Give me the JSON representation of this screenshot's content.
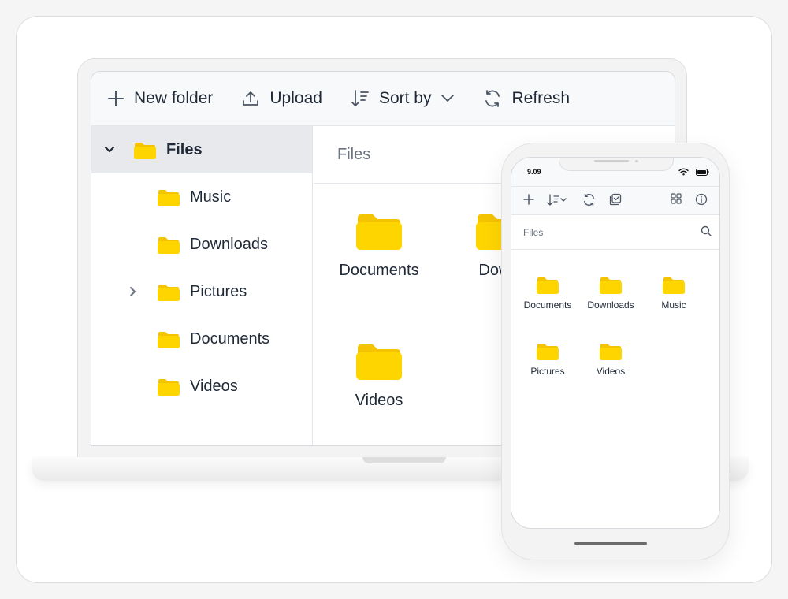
{
  "desktop": {
    "toolbar": {
      "new_folder_label": "New folder",
      "upload_label": "Upload",
      "sort_by_label": "Sort by",
      "refresh_label": "Refresh"
    },
    "sidebar": {
      "root": {
        "label": "Files",
        "expanded": true
      },
      "items": [
        {
          "label": "Music"
        },
        {
          "label": "Downloads"
        },
        {
          "label": "Pictures",
          "has_children": true
        },
        {
          "label": "Documents"
        },
        {
          "label": "Videos"
        }
      ]
    },
    "content": {
      "breadcrumb": "Files",
      "tiles": [
        {
          "label": "Documents"
        },
        {
          "label": "Down"
        },
        {
          "label": "Videos"
        }
      ]
    }
  },
  "mobile": {
    "status": {
      "time": "9.09"
    },
    "search_placeholder": "Files",
    "tiles": [
      {
        "label": "Documents"
      },
      {
        "label": "Downloads"
      },
      {
        "label": "Music"
      },
      {
        "label": "Pictures"
      },
      {
        "label": "Videos"
      }
    ]
  },
  "colors": {
    "folder": "#FFD500",
    "folder_back": "#F5C400",
    "selected_row": "#e8e9ec",
    "toolbar_bg": "#f8f9fb"
  },
  "icons": [
    "plus-icon",
    "upload-icon",
    "sort-icon",
    "chevron-down-icon",
    "refresh-icon",
    "folder-icon",
    "chevron-right-icon",
    "search-icon",
    "select-icon",
    "grid-icon",
    "info-icon",
    "wifi-icon",
    "battery-icon"
  ]
}
